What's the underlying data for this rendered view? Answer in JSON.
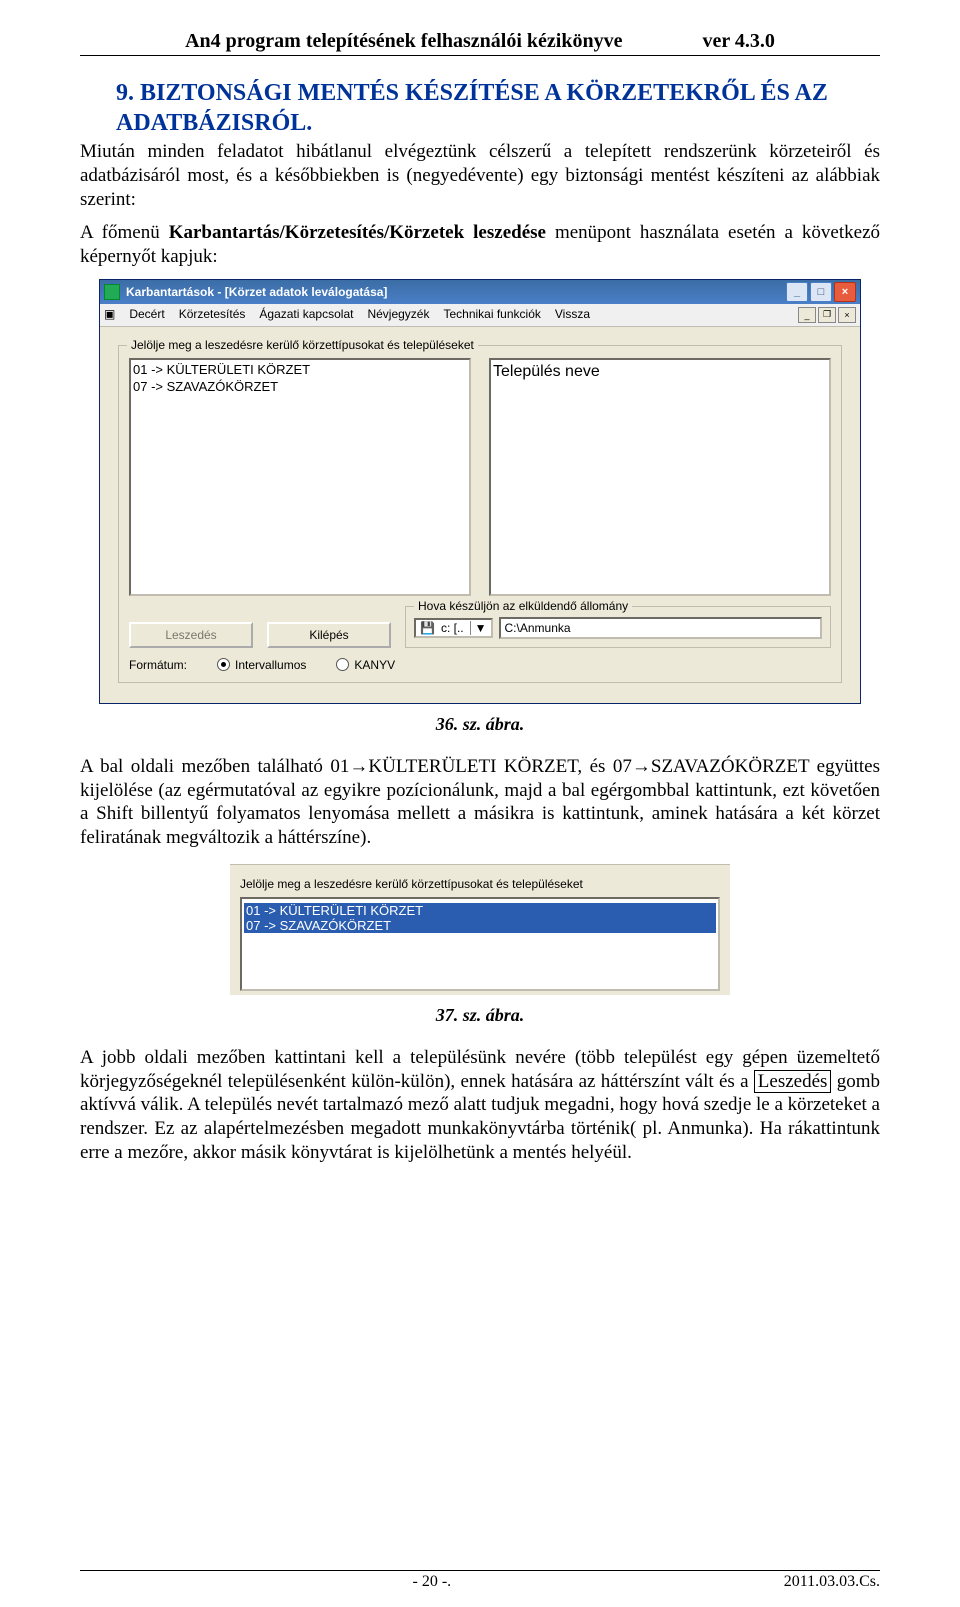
{
  "header": {
    "title": "An4 program telepítésének felhasználói kézikönyve",
    "ver": "ver 4.3.0"
  },
  "section": {
    "num_title_line1": "9. BIZTONSÁGI MENTÉS KÉSZÍTÉSE A KÖRZETEKRŐL ÉS AZ",
    "num_title_line2": "ADATBÁZISRÓL."
  },
  "para1_a": "Miután minden feladatot hibátlanul elvégeztünk célszerű a telepített rendszerünk körzeteiről és adatbázisáról most, és a későbbiekben is (negyedévente) egy biztonsági mentést készíteni az alábbiak szerint:",
  "para1_b_pre": "A főmenü ",
  "para1_b_bold": "Karbantartás/Körzetesítés/Körzetek leszedése",
  "para1_b_post": " menüpont használata esetén a következő képernyőt kapjuk:",
  "win1": {
    "title": "Karbantartások - [Körzet adatok leválogatása]",
    "menu": [
      "Decért",
      "Körzetesítés",
      "Ágazati kapcsolat",
      "Névjegyzék",
      "Technikai funkciók",
      "Vissza"
    ],
    "group_label": "Jelölje meg a leszedésre kerülő körzettípusokat és településeket",
    "left_items": [
      "01 -> KÜLTERÜLETI KÖRZET",
      "07 -> SZAVAZÓKÖRZET"
    ],
    "right_items": [
      "Település neve"
    ],
    "btn_leszedes": "Leszedés",
    "btn_kilepes": "Kilépés",
    "hova_label": "Hova készüljön az elküldendő állomány",
    "drive_text": "c: [..",
    "drive_chev": "▼",
    "path_value": "C:\\Anmunka",
    "fmt_label": "Formátum:",
    "radio1": "Intervallumos",
    "radio2": "KANYV",
    "min": "_",
    "max": "□",
    "restore": "▫",
    "close": "×"
  },
  "fig1": "36. sz. ábra.",
  "para2": "A bal oldali mezőben található 01→KÜLTERÜLETI KÖRZET, és 07→SZAVAZÓKÖRZET együttes kijelölése (az egérmutatóval az egyikre pozícionálunk, majd a bal egérgombbal kattintunk, ezt követően a Shift billentyű folyamatos lenyomása mellett a másikra is kattintunk, aminek hatására a két körzet feliratának megváltozik a háttérszíne).",
  "win2": {
    "group_label": "Jelölje meg a leszedésre kerülő körzettípusokat és településeket",
    "items": [
      "01 -> KÜLTERÜLETI KÖRZET",
      "07 -> SZAVAZÓKÖRZET"
    ]
  },
  "fig2": "37. sz. ábra.",
  "para3_pre": "A jobb oldali mezőben kattintani kell a településünk nevére (több települést egy gépen üzemeltető körjegyzőségeknél településenként külön-külön), ennek hatására az háttérszínt vált és a ",
  "para3_box": "Leszedés",
  "para3_post": " gomb aktívvá válik. A település nevét tartalmazó mező alatt tudjuk megadni, hogy hová szedje le a körzeteket a rendszer. Ez az alapértelmezésben megadott munkakönyvtárba történik( pl. Anmunka). Ha rákattintunk erre a mezőre, akkor másik könyvtárat is kijelölhetünk a mentés helyéül.",
  "footer": {
    "page": "- 20 -.",
    "date": "2011.03.03.Cs."
  }
}
